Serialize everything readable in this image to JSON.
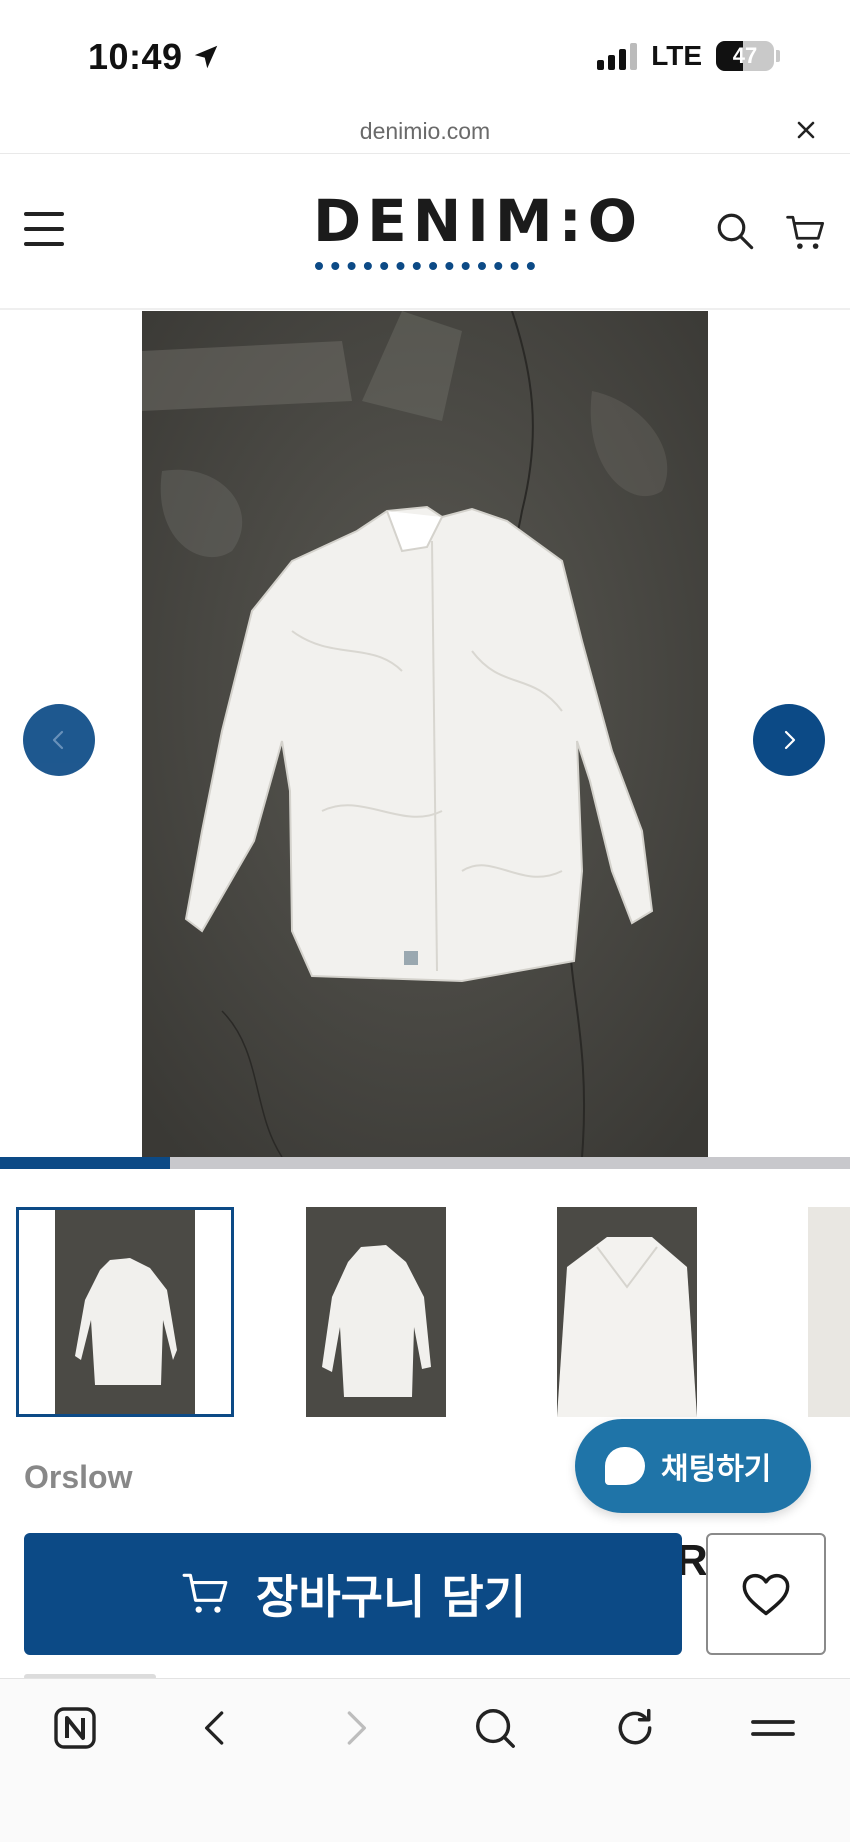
{
  "status_bar": {
    "time": "10:49",
    "network": "LTE",
    "battery": "47",
    "battery_level": 0.47
  },
  "browser": {
    "url": "denimio.com"
  },
  "header": {
    "logo": "DENIM:O"
  },
  "gallery": {
    "progress": 0.2
  },
  "chat": {
    "label": "채팅하기"
  },
  "product": {
    "brand": "Orslow",
    "title_peek": "R"
  },
  "actions": {
    "add_to_cart": "장바구니 담기"
  }
}
